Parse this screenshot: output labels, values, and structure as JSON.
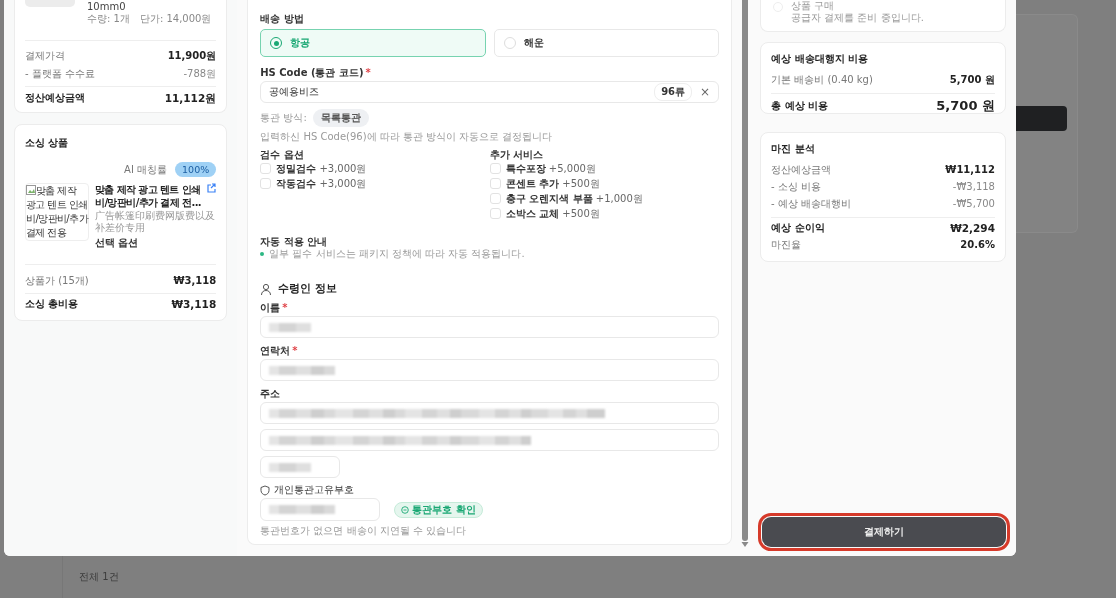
{
  "left_panel": {
    "order_item": {
      "option_text": "10mm0",
      "quantity": "수량: 1개",
      "unit_price": "단가: 14,000원"
    },
    "settlement": [
      {
        "label": "결제가격",
        "value": "11,900원",
        "kind": "normal"
      },
      {
        "label": "- 플랫폼 수수료",
        "value": "-788원",
        "kind": "deduction"
      },
      {
        "label": "정산예상금액",
        "value": "11,112원",
        "kind": "total"
      }
    ],
    "sourcing": {
      "title": "소싱 상품",
      "match_label": "AI 매칭률",
      "match_badge": "100%",
      "image_alt": "맞춤 제작 광고 텐트 인쇄비/망판비/추가 결제 전용",
      "product_title": "맞춤 제작 광고 텐트 인쇄비/망판비/추가 결제 전...",
      "product_subtitle": "广告帐篷印刷费网版费以及补差价专用",
      "options_label": "선택 옵션",
      "rows": [
        {
          "label": "상품가 (15개)",
          "value": "₩3,118",
          "kind": "normal"
        },
        {
          "label": "소싱 총비용",
          "value": "₩3,118",
          "kind": "total"
        }
      ]
    }
  },
  "form": {
    "shipping_method": {
      "label": "배송 방법",
      "options": [
        {
          "label": "항공",
          "selected": true
        },
        {
          "label": "해운",
          "selected": false
        }
      ]
    },
    "hs_code": {
      "label": "HS Code (통관 코드)",
      "required_mark": "*",
      "value": "공예용비즈",
      "badge": "96류",
      "clear": "×"
    },
    "customs": {
      "label": "통관 방식:",
      "value": "목록통관",
      "hint": "입력하신 HS Code(96)에 따라 통관 방식이 자동으로 결정됩니다"
    },
    "inspection": {
      "title": "검수 옵션",
      "options": [
        {
          "name": "정밀검수",
          "price": "+3,000원",
          "checked": false
        },
        {
          "name": "작동검수",
          "price": "+3,000원",
          "checked": false
        }
      ]
    },
    "extra_services": {
      "title": "추가 서비스",
      "options": [
        {
          "name": "특수포장",
          "price": "+5,000원",
          "checked": false
        },
        {
          "name": "콘센트 추가",
          "price": "+500원",
          "checked": false
        },
        {
          "name": "충구 오렌지색 부품",
          "price": "+1,000원",
          "checked": false
        },
        {
          "name": "소박스 교체",
          "price": "+500원",
          "checked": false
        }
      ]
    },
    "auto_notice": {
      "title": "자동 적용 안내",
      "items": [
        "일부 필수 서비스는 패키지 정책에 따라 자동 적용됩니다."
      ]
    },
    "recipient": {
      "title": "수령인 정보",
      "fields": [
        {
          "label": "이름",
          "required_mark": "*",
          "kind": "full",
          "redacted": true
        },
        {
          "label": "연락처",
          "required_mark": "*",
          "kind": "full",
          "redacted": true
        },
        {
          "label": "주소",
          "kind": "full",
          "redacted": true
        },
        {
          "kind": "full",
          "redacted": true
        },
        {
          "kind": "zip",
          "redacted": true
        }
      ]
    },
    "customs_id": {
      "label": "개인통관고유부호",
      "redacted": true,
      "verify_button": "통관부호 확인",
      "hint": "통관번호가 없으면 배송이 지연될 수 있습니다"
    }
  },
  "summary": {
    "steps": [
      {
        "title": "상품 구매",
        "subtitle": "공급자 결제를 준비 중입니다.",
        "disabled": true
      }
    ],
    "shipping_cost": {
      "title": "예상 배송대행지 비용",
      "rows": [
        {
          "label": "기본 배송비 (0.40 kg)",
          "value": "5,700 원",
          "kind": "normal"
        },
        {
          "label": "총 예상 비용",
          "value": "5,700 원",
          "kind": "grand"
        }
      ]
    },
    "margin": {
      "title": "마진 분석",
      "rows": [
        {
          "label": "정산예상금액",
          "value": "₩11,112",
          "kind": "normal"
        },
        {
          "label": "- 소싱 비용",
          "value": "-₩3,118",
          "kind": "deduction"
        },
        {
          "label": "- 예상 배송대행비",
          "value": "-₩5,700",
          "kind": "deduction"
        },
        {
          "label": "예상 순이익",
          "value": "₩2,294",
          "kind": "total"
        },
        {
          "label": "마진율",
          "value": "20.6%",
          "kind": "normal"
        }
      ]
    },
    "pay_button": {
      "label": "결제하기",
      "highlighted": true
    }
  },
  "background": {
    "list_count": "전체 1건"
  }
}
